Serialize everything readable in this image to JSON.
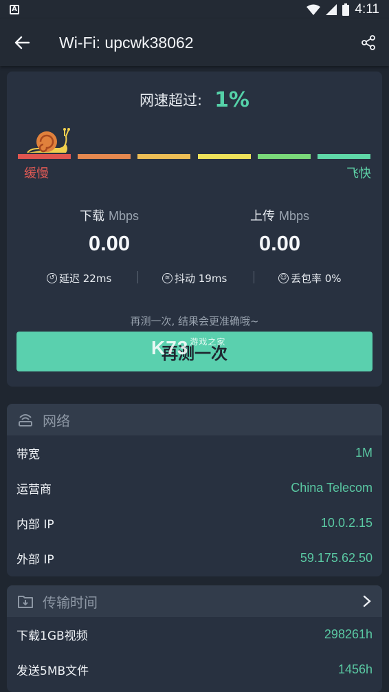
{
  "status_bar": {
    "time": "4:11",
    "left_badge": "A"
  },
  "app_bar": {
    "title": "Wi-Fi: upcwk38062"
  },
  "speed": {
    "exceed_label": "网速超过:",
    "exceed_value": "1%",
    "scale_slow": "缓慢",
    "scale_fast": "飞快",
    "scale_colors": [
      "#e0554f",
      "#e5884f",
      "#ecbd55",
      "#eee15a",
      "#7ad97a",
      "#5fd8a8"
    ],
    "download_label": "下载",
    "download_unit": "Mbps",
    "download_value": "0.00",
    "upload_label": "上传",
    "upload_unit": "Mbps",
    "upload_value": "0.00",
    "latency": "延迟 22ms",
    "jitter": "抖动 19ms",
    "loss": "丢包率 0%",
    "hint": "再测一次, 结果会更准确哦~",
    "retest_label": "再测一次",
    "watermark": "K73",
    "watermark_sub": "游戏之家"
  },
  "network": {
    "title": "网络",
    "rows": [
      {
        "key": "带宽",
        "value": "1M"
      },
      {
        "key": "运营商",
        "value": "China Telecom"
      },
      {
        "key": "内部 IP",
        "value": "10.0.2.15"
      },
      {
        "key": "外部 IP",
        "value": "59.175.62.50"
      }
    ]
  },
  "transfer": {
    "title": "传输时间",
    "rows": [
      {
        "key": "下载1GB视频",
        "value": "298261h"
      },
      {
        "key": "发送5MB文件",
        "value": "1456h"
      }
    ]
  },
  "colors": {
    "accent": "#5ad0ae",
    "background": "#1f2630",
    "card": "#283140"
  }
}
